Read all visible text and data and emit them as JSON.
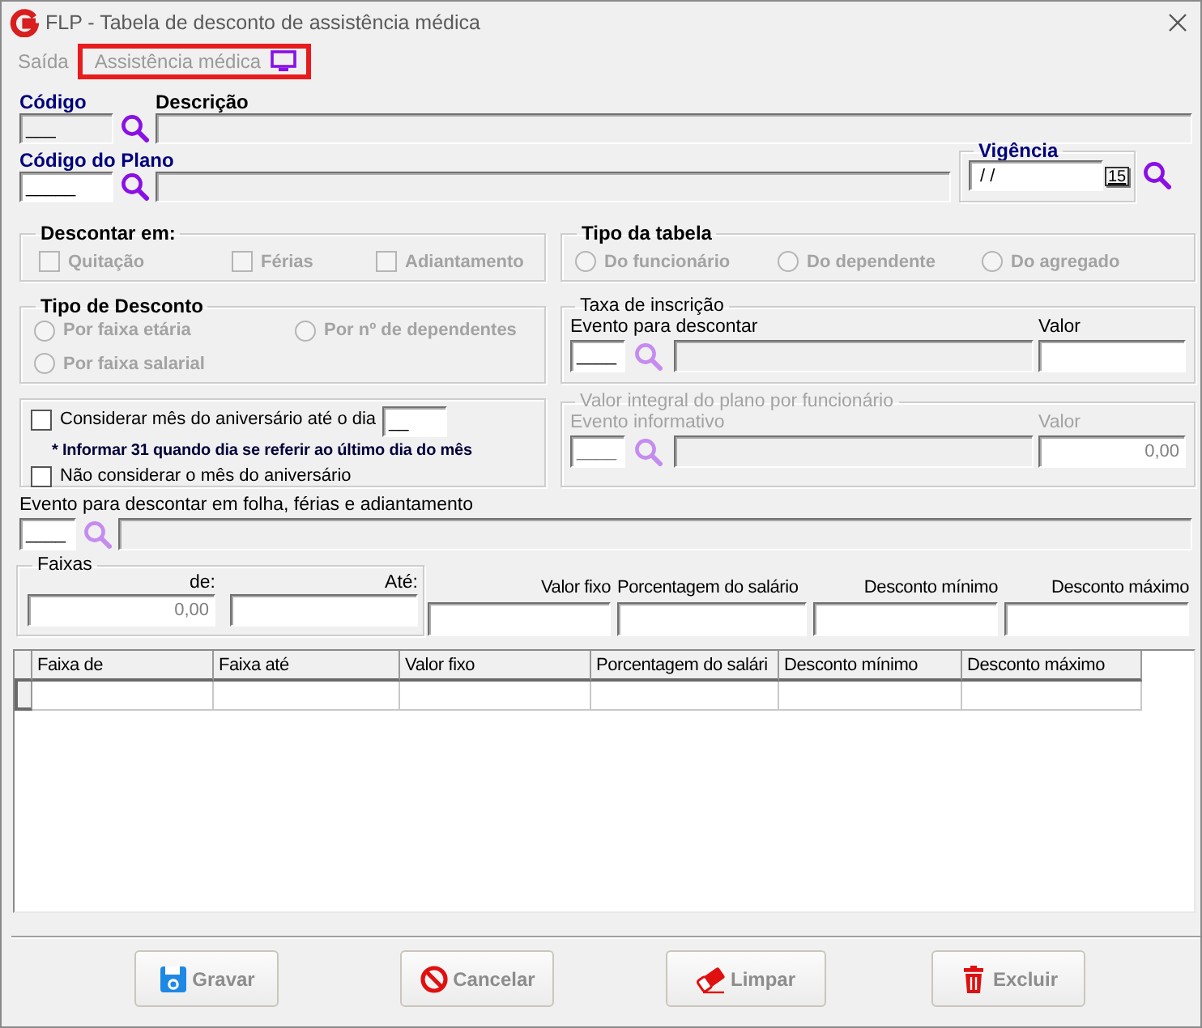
{
  "window": {
    "title": "FLP - Tabela de desconto de assistência médica"
  },
  "menu": [
    {
      "label": "Saída",
      "highlighted": false
    },
    {
      "label": "Assistência médica",
      "highlighted": true
    }
  ],
  "codigo": {
    "label": "Código",
    "value": "___",
    "disabled": true
  },
  "descricao": {
    "label": "Descrição",
    "disabled": true
  },
  "codigo_plano": {
    "label": "Código do Plano",
    "value": "_____",
    "disabled": false
  },
  "descricao_plano": {
    "disabled": true
  },
  "vigencia": {
    "title": "Vigência",
    "value": " / /",
    "calendar_button": "15"
  },
  "descontar_em": {
    "title": "Descontar em:",
    "disabled": true,
    "options": [
      {
        "label": "Quitação",
        "checked": false
      },
      {
        "label": "Férias",
        "checked": false
      },
      {
        "label": "Adiantamento",
        "checked": false
      }
    ]
  },
  "tipo_tabela": {
    "title": "Tipo da tabela",
    "disabled": true,
    "options": [
      {
        "label": "Do funcionário",
        "selected": false
      },
      {
        "label": "Do dependente",
        "selected": false
      },
      {
        "label": "Do agregado",
        "selected": false
      }
    ]
  },
  "tipo_desconto": {
    "title": "Tipo de Desconto",
    "disabled": true,
    "options": [
      {
        "label": "Por faixa etária",
        "selected": false
      },
      {
        "label": "Por nº de dependentes",
        "selected": false
      },
      {
        "label": "Por faixa salarial",
        "selected": false
      }
    ]
  },
  "taxa_inscricao": {
    "title": "Taxa de inscrição",
    "disabled": false,
    "evento_label": "Evento para descontar",
    "evento_value": "____",
    "valor_label": "Valor"
  },
  "aniversario": {
    "checks": [
      {
        "label": "Considerar mês do aniversário até o dia",
        "checked": false
      },
      {
        "label": "Não considerar o mês do aniversário",
        "checked": false
      }
    ],
    "dia": "__",
    "note": "* Informar 31 quando dia se referir ao último dia do mês"
  },
  "valor_integral": {
    "title": "Valor integral do plano por funcionário",
    "disabled": true,
    "evento_label": "Evento informativo",
    "evento_value": "____",
    "valor_label": "Valor",
    "valor": "0,00"
  },
  "evento_folha": {
    "label": "Evento para descontar em folha, férias e adiantamento",
    "value": "____"
  },
  "faixas": {
    "title": "Faixas",
    "de_label": "de:",
    "de_value": "0,00",
    "ate_label": "Até:"
  },
  "valores": [
    {
      "label": "Valor fixo"
    },
    {
      "label": "Porcentagem do salário"
    },
    {
      "label": "Desconto mínimo"
    },
    {
      "label": "Desconto máximo"
    }
  ],
  "table": {
    "columns": [
      "Faixa de",
      "Faixa até",
      "Valor fixo",
      "Porcentagem do salári",
      "Desconto mínimo",
      "Desconto máximo"
    ]
  },
  "buttons": [
    {
      "label": "Gravar",
      "kind": "save",
      "disabled": true
    },
    {
      "label": "Cancelar",
      "kind": "cancel",
      "disabled": true
    },
    {
      "label": "Limpar",
      "kind": "clear",
      "disabled": true
    },
    {
      "label": "Excluir",
      "kind": "delete",
      "disabled": true
    }
  ]
}
